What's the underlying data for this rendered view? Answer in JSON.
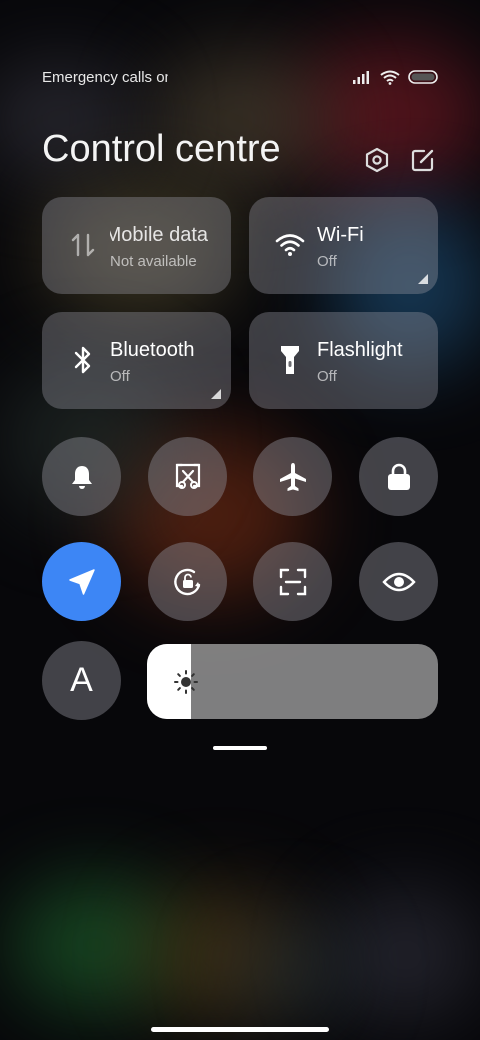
{
  "status_bar": {
    "text": "Emergency calls only",
    "icons": [
      "signal-icon",
      "wifi-icon",
      "battery-icon"
    ]
  },
  "header": {
    "title": "Control centre",
    "icons": [
      "settings-icon",
      "edit-icon"
    ]
  },
  "tiles": [
    {
      "name": "Mobile data",
      "status": "Not available",
      "icon": "mobile-data-icon"
    },
    {
      "name": "Wi-Fi",
      "status": "Off",
      "icon": "wifi-icon"
    },
    {
      "name": "Bluetooth",
      "status": "Off",
      "icon": "bluetooth-icon"
    },
    {
      "name": "Flashlight",
      "status": "Off",
      "icon": "flashlight-icon"
    }
  ],
  "toggles": [
    {
      "icon": "bell-icon"
    },
    {
      "icon": "screenshot-icon"
    },
    {
      "icon": "airplane-icon"
    },
    {
      "icon": "lock-icon"
    },
    {
      "icon": "location-icon",
      "active": true
    },
    {
      "icon": "rotation-lock-icon"
    },
    {
      "icon": "scan-icon"
    },
    {
      "icon": "eye-icon"
    }
  ],
  "font_button": {
    "label": "A"
  },
  "brightness": {
    "level": 0.15
  },
  "colors": {
    "accent": "#3d86f5"
  }
}
